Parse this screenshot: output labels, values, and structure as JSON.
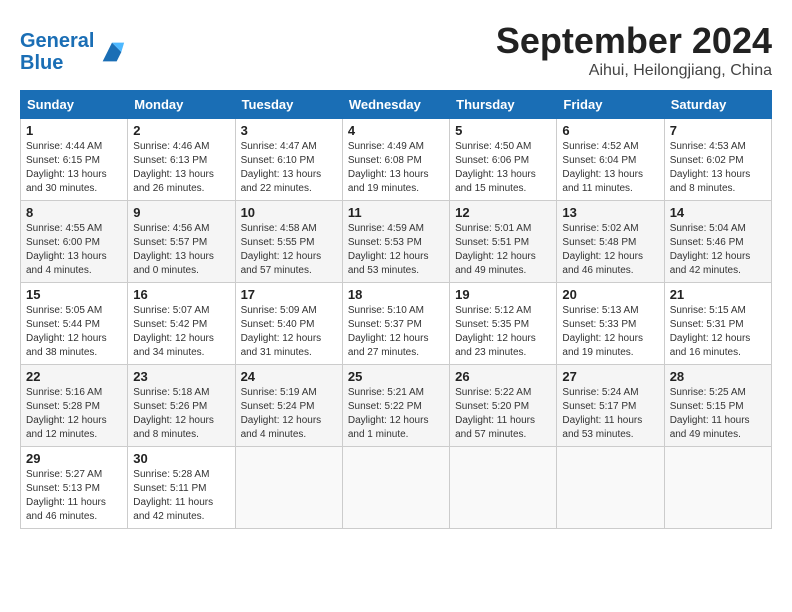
{
  "header": {
    "logo_line1": "General",
    "logo_line2": "Blue",
    "month_title": "September 2024",
    "location": "Aihui, Heilongjiang, China"
  },
  "weekdays": [
    "Sunday",
    "Monday",
    "Tuesday",
    "Wednesday",
    "Thursday",
    "Friday",
    "Saturday"
  ],
  "weeks": [
    [
      {
        "day": "1",
        "sunrise": "Sunrise: 4:44 AM",
        "sunset": "Sunset: 6:15 PM",
        "daylight": "Daylight: 13 hours and 30 minutes."
      },
      {
        "day": "2",
        "sunrise": "Sunrise: 4:46 AM",
        "sunset": "Sunset: 6:13 PM",
        "daylight": "Daylight: 13 hours and 26 minutes."
      },
      {
        "day": "3",
        "sunrise": "Sunrise: 4:47 AM",
        "sunset": "Sunset: 6:10 PM",
        "daylight": "Daylight: 13 hours and 22 minutes."
      },
      {
        "day": "4",
        "sunrise": "Sunrise: 4:49 AM",
        "sunset": "Sunset: 6:08 PM",
        "daylight": "Daylight: 13 hours and 19 minutes."
      },
      {
        "day": "5",
        "sunrise": "Sunrise: 4:50 AM",
        "sunset": "Sunset: 6:06 PM",
        "daylight": "Daylight: 13 hours and 15 minutes."
      },
      {
        "day": "6",
        "sunrise": "Sunrise: 4:52 AM",
        "sunset": "Sunset: 6:04 PM",
        "daylight": "Daylight: 13 hours and 11 minutes."
      },
      {
        "day": "7",
        "sunrise": "Sunrise: 4:53 AM",
        "sunset": "Sunset: 6:02 PM",
        "daylight": "Daylight: 13 hours and 8 minutes."
      }
    ],
    [
      {
        "day": "8",
        "sunrise": "Sunrise: 4:55 AM",
        "sunset": "Sunset: 6:00 PM",
        "daylight": "Daylight: 13 hours and 4 minutes."
      },
      {
        "day": "9",
        "sunrise": "Sunrise: 4:56 AM",
        "sunset": "Sunset: 5:57 PM",
        "daylight": "Daylight: 13 hours and 0 minutes."
      },
      {
        "day": "10",
        "sunrise": "Sunrise: 4:58 AM",
        "sunset": "Sunset: 5:55 PM",
        "daylight": "Daylight: 12 hours and 57 minutes."
      },
      {
        "day": "11",
        "sunrise": "Sunrise: 4:59 AM",
        "sunset": "Sunset: 5:53 PM",
        "daylight": "Daylight: 12 hours and 53 minutes."
      },
      {
        "day": "12",
        "sunrise": "Sunrise: 5:01 AM",
        "sunset": "Sunset: 5:51 PM",
        "daylight": "Daylight: 12 hours and 49 minutes."
      },
      {
        "day": "13",
        "sunrise": "Sunrise: 5:02 AM",
        "sunset": "Sunset: 5:48 PM",
        "daylight": "Daylight: 12 hours and 46 minutes."
      },
      {
        "day": "14",
        "sunrise": "Sunrise: 5:04 AM",
        "sunset": "Sunset: 5:46 PM",
        "daylight": "Daylight: 12 hours and 42 minutes."
      }
    ],
    [
      {
        "day": "15",
        "sunrise": "Sunrise: 5:05 AM",
        "sunset": "Sunset: 5:44 PM",
        "daylight": "Daylight: 12 hours and 38 minutes."
      },
      {
        "day": "16",
        "sunrise": "Sunrise: 5:07 AM",
        "sunset": "Sunset: 5:42 PM",
        "daylight": "Daylight: 12 hours and 34 minutes."
      },
      {
        "day": "17",
        "sunrise": "Sunrise: 5:09 AM",
        "sunset": "Sunset: 5:40 PM",
        "daylight": "Daylight: 12 hours and 31 minutes."
      },
      {
        "day": "18",
        "sunrise": "Sunrise: 5:10 AM",
        "sunset": "Sunset: 5:37 PM",
        "daylight": "Daylight: 12 hours and 27 minutes."
      },
      {
        "day": "19",
        "sunrise": "Sunrise: 5:12 AM",
        "sunset": "Sunset: 5:35 PM",
        "daylight": "Daylight: 12 hours and 23 minutes."
      },
      {
        "day": "20",
        "sunrise": "Sunrise: 5:13 AM",
        "sunset": "Sunset: 5:33 PM",
        "daylight": "Daylight: 12 hours and 19 minutes."
      },
      {
        "day": "21",
        "sunrise": "Sunrise: 5:15 AM",
        "sunset": "Sunset: 5:31 PM",
        "daylight": "Daylight: 12 hours and 16 minutes."
      }
    ],
    [
      {
        "day": "22",
        "sunrise": "Sunrise: 5:16 AM",
        "sunset": "Sunset: 5:28 PM",
        "daylight": "Daylight: 12 hours and 12 minutes."
      },
      {
        "day": "23",
        "sunrise": "Sunrise: 5:18 AM",
        "sunset": "Sunset: 5:26 PM",
        "daylight": "Daylight: 12 hours and 8 minutes."
      },
      {
        "day": "24",
        "sunrise": "Sunrise: 5:19 AM",
        "sunset": "Sunset: 5:24 PM",
        "daylight": "Daylight: 12 hours and 4 minutes."
      },
      {
        "day": "25",
        "sunrise": "Sunrise: 5:21 AM",
        "sunset": "Sunset: 5:22 PM",
        "daylight": "Daylight: 12 hours and 1 minute."
      },
      {
        "day": "26",
        "sunrise": "Sunrise: 5:22 AM",
        "sunset": "Sunset: 5:20 PM",
        "daylight": "Daylight: 11 hours and 57 minutes."
      },
      {
        "day": "27",
        "sunrise": "Sunrise: 5:24 AM",
        "sunset": "Sunset: 5:17 PM",
        "daylight": "Daylight: 11 hours and 53 minutes."
      },
      {
        "day": "28",
        "sunrise": "Sunrise: 5:25 AM",
        "sunset": "Sunset: 5:15 PM",
        "daylight": "Daylight: 11 hours and 49 minutes."
      }
    ],
    [
      {
        "day": "29",
        "sunrise": "Sunrise: 5:27 AM",
        "sunset": "Sunset: 5:13 PM",
        "daylight": "Daylight: 11 hours and 46 minutes."
      },
      {
        "day": "30",
        "sunrise": "Sunrise: 5:28 AM",
        "sunset": "Sunset: 5:11 PM",
        "daylight": "Daylight: 11 hours and 42 minutes."
      },
      {
        "day": "",
        "sunrise": "",
        "sunset": "",
        "daylight": ""
      },
      {
        "day": "",
        "sunrise": "",
        "sunset": "",
        "daylight": ""
      },
      {
        "day": "",
        "sunrise": "",
        "sunset": "",
        "daylight": ""
      },
      {
        "day": "",
        "sunrise": "",
        "sunset": "",
        "daylight": ""
      },
      {
        "day": "",
        "sunrise": "",
        "sunset": "",
        "daylight": ""
      }
    ]
  ]
}
